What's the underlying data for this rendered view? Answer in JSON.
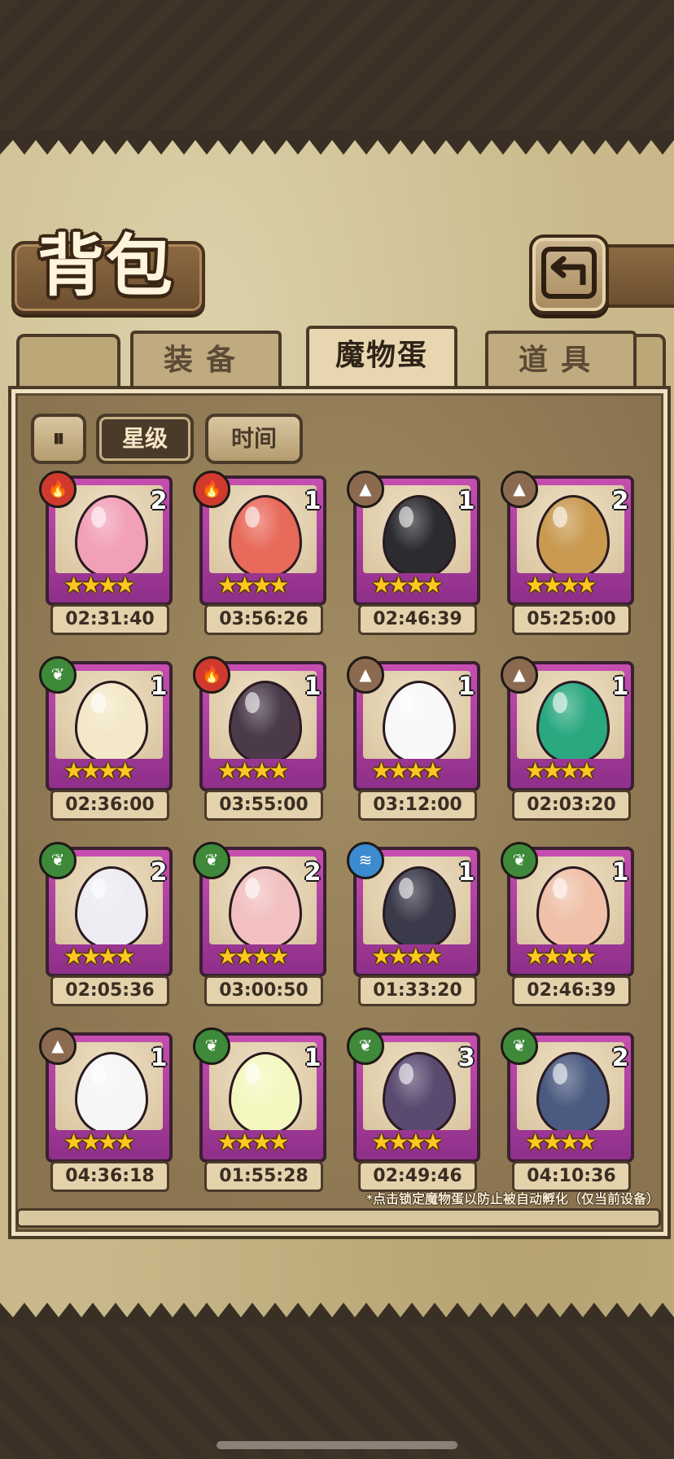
{
  "header": {
    "title": "背包",
    "back_icon": "return-arrow-icon"
  },
  "tabs": [
    {
      "label": "装备",
      "active": false
    },
    {
      "label": "魔物蛋",
      "active": true
    },
    {
      "label": "道具",
      "active": false
    }
  ],
  "sort": {
    "toggle_label": "⏸",
    "by_star": "星级",
    "by_time": "时间",
    "active": "星级"
  },
  "eggs": [
    {
      "element": "fire",
      "count": "2",
      "stars": "★★★★",
      "timer": "02:31:40",
      "color": "#f2a0b8"
    },
    {
      "element": "fire",
      "count": "1",
      "stars": "★★★★",
      "timer": "03:56:26",
      "color": "#e86a5a"
    },
    {
      "element": "earth",
      "count": "1",
      "stars": "★★★★",
      "timer": "02:46:39",
      "color": "#2c2c30"
    },
    {
      "element": "earth",
      "count": "2",
      "stars": "★★★★",
      "timer": "05:25:00",
      "color": "#c99a50"
    },
    {
      "element": "grass",
      "count": "1",
      "stars": "★★★★",
      "timer": "02:36:00",
      "color": "#f3e8c8"
    },
    {
      "element": "fire",
      "count": "1",
      "stars": "★★★★",
      "timer": "03:55:00",
      "color": "#4a3a4a"
    },
    {
      "element": "earth",
      "count": "1",
      "stars": "★★★★",
      "timer": "03:12:00",
      "color": "#f8f8f8"
    },
    {
      "element": "earth",
      "count": "1",
      "stars": "★★★★",
      "timer": "02:03:20",
      "color": "#2aa880"
    },
    {
      "element": "grass",
      "count": "2",
      "stars": "★★★★",
      "timer": "02:05:36",
      "color": "#ececf2"
    },
    {
      "element": "grass",
      "count": "2",
      "stars": "★★★★",
      "timer": "03:00:50",
      "color": "#f2c0c0"
    },
    {
      "element": "water",
      "count": "1",
      "stars": "★★★★",
      "timer": "01:33:20",
      "color": "#3a3a4a"
    },
    {
      "element": "grass",
      "count": "1",
      "stars": "★★★★",
      "timer": "02:46:39",
      "color": "#f0c0a8"
    },
    {
      "element": "earth",
      "count": "1",
      "stars": "★★★★",
      "timer": "04:36:18",
      "color": "#f6f6f6"
    },
    {
      "element": "grass",
      "count": "1",
      "stars": "★★★★",
      "timer": "01:55:28",
      "color": "#f4f8c0"
    },
    {
      "element": "grass",
      "count": "3",
      "stars": "★★★★",
      "timer": "02:49:46",
      "color": "#5a4a70"
    },
    {
      "element": "grass",
      "count": "2",
      "stars": "★★★★",
      "timer": "04:10:36",
      "color": "#4a5a80"
    }
  ],
  "footnote": "*点击锁定魔物蛋以防止被自动孵化（仅当前设备）",
  "colors": {
    "card_frame": "#b0449e",
    "star": "#ffc820",
    "parchment": "#c9b98a"
  }
}
